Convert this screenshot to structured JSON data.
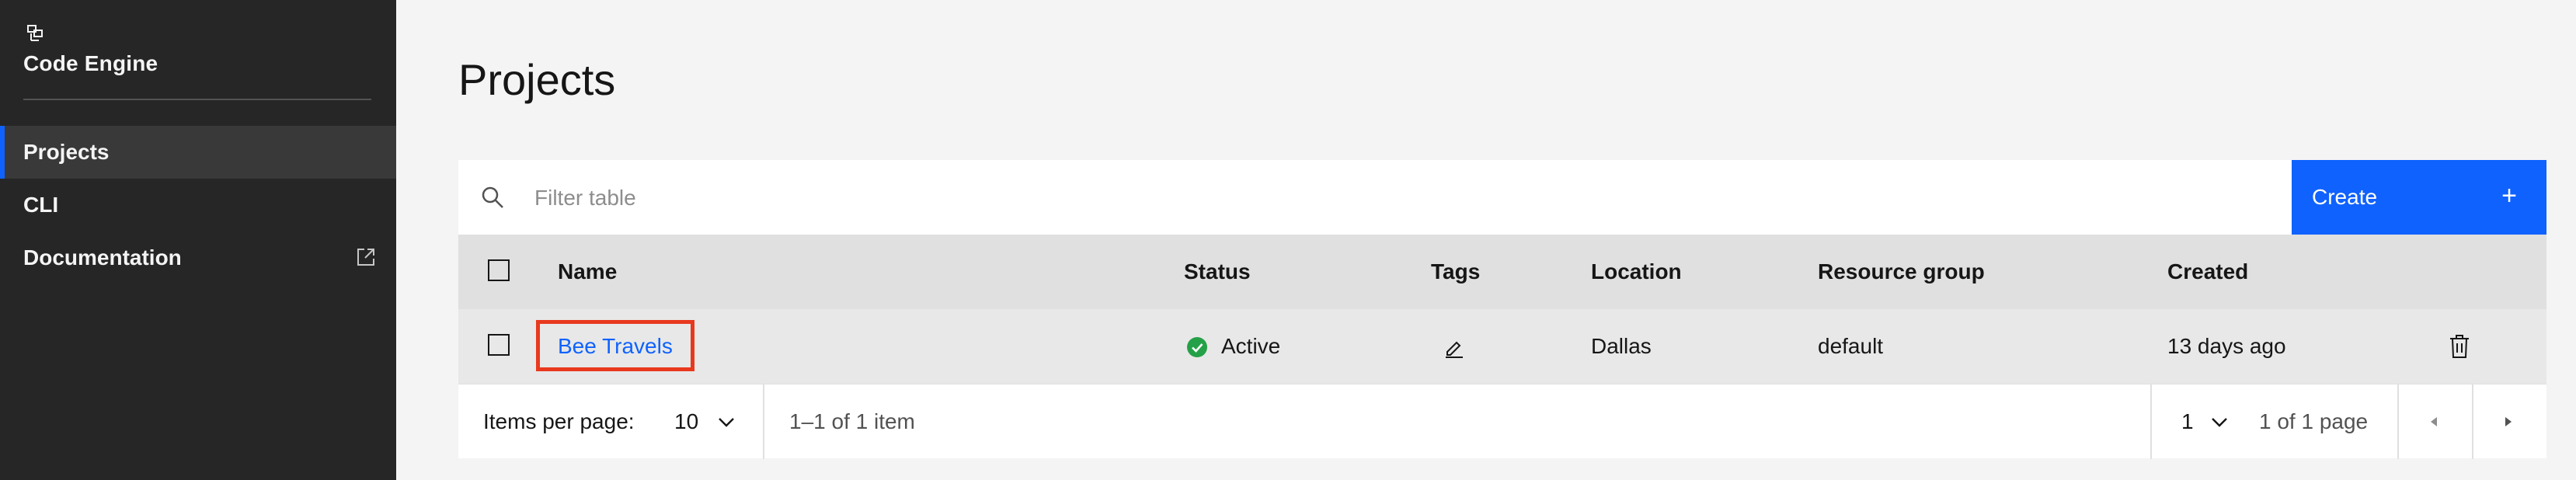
{
  "sidebar": {
    "app_title": "Code Engine",
    "brand_icon": "code-engine-icon",
    "items": [
      {
        "label": "Projects",
        "active": true
      },
      {
        "label": "CLI",
        "active": false
      },
      {
        "label": "Documentation",
        "active": false,
        "icon": "external-link-icon"
      }
    ]
  },
  "main": {
    "title": "Projects",
    "search": {
      "placeholder": "Filter table",
      "value": ""
    },
    "create_label": "Create",
    "create_icon": "plus-icon",
    "table": {
      "columns": [
        "Name",
        "Status",
        "Tags",
        "Location",
        "Resource group",
        "Created"
      ],
      "rows": [
        {
          "name": "Bee Travels",
          "status": "Active",
          "status_icon": "check-circle-icon",
          "tags_icon": "edit-icon",
          "location": "Dallas",
          "resource_group": "default",
          "created": "13 days ago",
          "action_icon": "trash-icon"
        }
      ]
    },
    "pagination": {
      "items_per_page_label": "Items per page:",
      "items_per_page_value": "10",
      "range_text": "1–1 of 1 item",
      "page_value": "1",
      "page_total_text": "1 of 1 page"
    }
  },
  "colors": {
    "accent": "#0f62fe",
    "sidebar_bg": "#262626",
    "success": "#24a148",
    "highlight": "#e8391e"
  }
}
